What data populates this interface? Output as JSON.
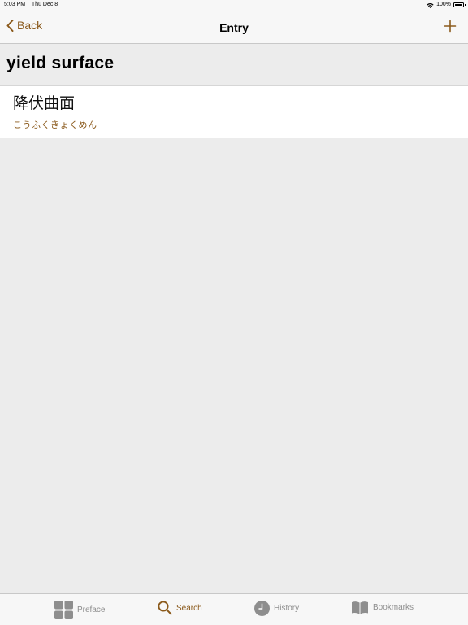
{
  "status_bar": {
    "time": "5:03 PM",
    "date": "Thu Dec 8",
    "battery_percent": "100%",
    "battery_level": 1.0
  },
  "nav": {
    "back_label": "Back",
    "title": "Entry",
    "add_icon": "plus-icon"
  },
  "entry": {
    "term": "yield surface",
    "kanji": "降伏曲面",
    "reading": "こうふくきょくめん"
  },
  "tabs": [
    {
      "label": "Preface",
      "icon": "grid-icon",
      "active": false
    },
    {
      "label": "Search",
      "icon": "search-icon",
      "active": true
    },
    {
      "label": "History",
      "icon": "clock-icon",
      "active": false
    },
    {
      "label": "Bookmarks",
      "icon": "book-icon",
      "active": false
    }
  ],
  "colors": {
    "accent": "#8b5a1c",
    "inactive": "#8e8e8e",
    "background": "#ececec"
  }
}
